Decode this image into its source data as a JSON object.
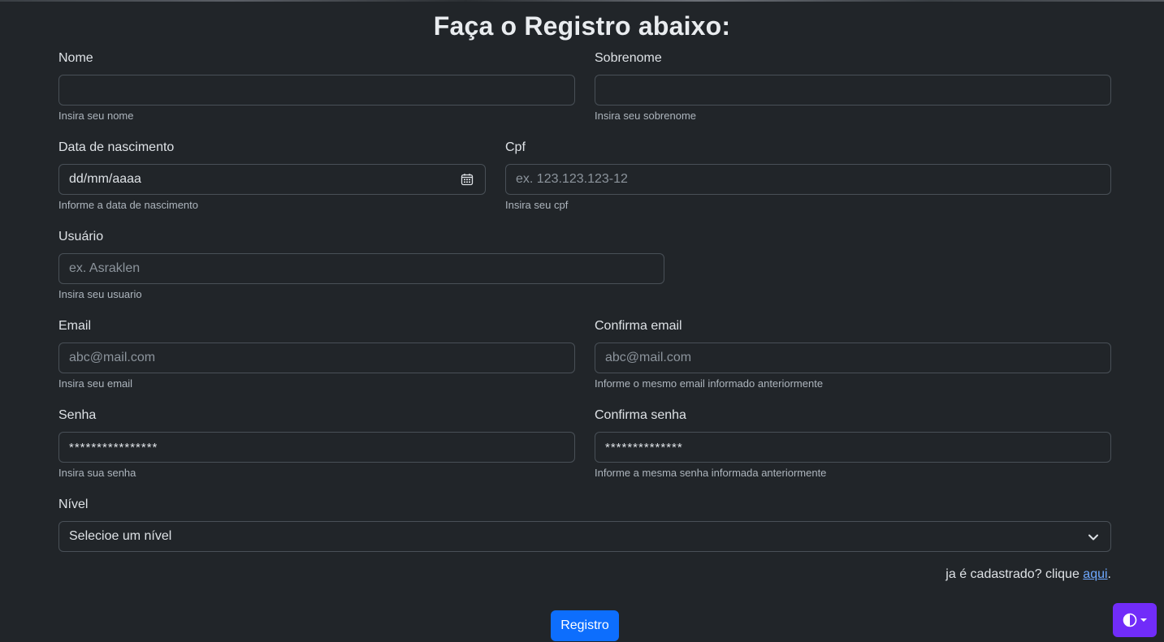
{
  "page": {
    "title": "Faça o Registro abaixo:"
  },
  "form": {
    "nome": {
      "label": "Nome",
      "placeholder": "",
      "help": "Insira seu nome"
    },
    "sobrenome": {
      "label": "Sobrenome",
      "placeholder": "",
      "help": "Insira seu sobrenome"
    },
    "nascimento": {
      "label": "Data de nascimento",
      "value": "dd/mm/aaaa",
      "help": "Informe a data de nascimento",
      "icon": "calendar-icon"
    },
    "cpf": {
      "label": "Cpf",
      "placeholder": "ex. 123.123.123-12",
      "help": "Insira seu cpf"
    },
    "usuario": {
      "label": "Usuário",
      "placeholder": "ex. Asraklen",
      "help": "Insira seu usuario"
    },
    "email": {
      "label": "Email",
      "placeholder": "abc@mail.com",
      "help": "Insira seu email"
    },
    "confirma_email": {
      "label": "Confirma email",
      "placeholder": "abc@mail.com",
      "help": "Informe o mesmo email informado anteriormente"
    },
    "senha": {
      "label": "Senha",
      "value": "****************",
      "help": "Insira sua senha"
    },
    "confirma_senha": {
      "label": "Confirma senha",
      "value": "**************",
      "help": "Informe a mesma senha informada anteriormente"
    },
    "nivel": {
      "label": "Nível",
      "selected": "Selecioe um nível",
      "icon": "chevron-down-icon"
    }
  },
  "login_prompt": {
    "text": "ja é cadastrado? clique ",
    "link": "aqui",
    "suffix": "."
  },
  "submit": {
    "label": "Registro"
  },
  "theme_toggle": {
    "icon": "contrast-icon",
    "accent": "#712cf9"
  },
  "colors": {
    "background": "#212529",
    "primary": "#0d6efd",
    "link": "#6ea8fe"
  }
}
